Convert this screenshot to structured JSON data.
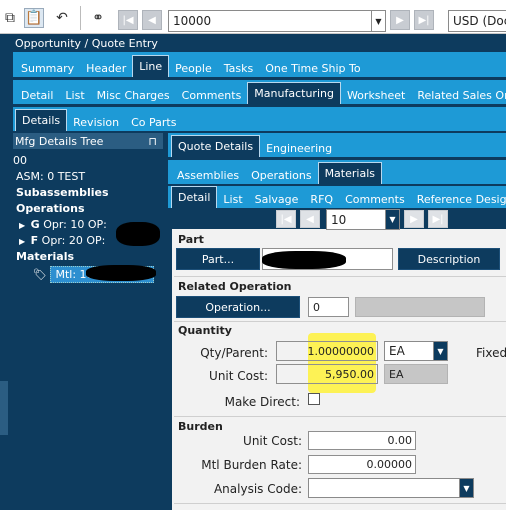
{
  "toolbar": {
    "icons": [
      "copy-icon",
      "clipboard-icon",
      "undo-icon",
      "binoculars-icon"
    ],
    "record_value": "10000",
    "currency_value": "USD (Doc"
  },
  "window_title": "Opportunity / Quote Entry",
  "main_tabs": [
    "Summary",
    "Header",
    "Line",
    "People",
    "Tasks",
    "One Time Ship To"
  ],
  "line_tabs": [
    "Detail",
    "List",
    "Misc Charges",
    "Comments",
    "Manufacturing",
    "Worksheet",
    "Related Sales Order"
  ],
  "mfg_tabs": [
    "Details",
    "Revision",
    "Co Parts"
  ],
  "tree": {
    "header": "Mfg Details Tree",
    "pin": "⊓",
    "line0": "00",
    "asm": "ASM: 0 TEST",
    "subassemblies": "Subassemblies",
    "operations": "Operations",
    "op1": "Opr: 10 OP: ",
    "op2": "Opr: 20 OP: ",
    "materials": "Materials",
    "mtl": "Mtl: 10"
  },
  "detail_tabs": [
    "Quote Details",
    "Engineering"
  ],
  "qd_tabs": [
    "Assemblies",
    "Operations",
    "Materials"
  ],
  "mat_tabs": [
    "Detail",
    "List",
    "Salvage",
    "RFQ",
    "Comments",
    "Reference Design"
  ],
  "seq_value": "10",
  "part": {
    "section": "Part",
    "part_button": "Part...",
    "description_button": "Description"
  },
  "related_operation": {
    "section": "Related Operation",
    "operation_button": "Operation...",
    "operation_value": "0"
  },
  "quantity": {
    "section": "Quantity",
    "qty_parent_label": "Qty/Parent:",
    "qty_parent_value": "1.00000000",
    "qty_uom": "EA",
    "unit_cost_label": "Unit Cost:",
    "unit_cost_value": "5,950.00",
    "unit_cost_uom": "EA",
    "make_direct_label": "Make Direct:",
    "fixed_label": "Fixed"
  },
  "burden": {
    "section": "Burden",
    "unit_cost_label": "Unit Cost:",
    "unit_cost_value": "0.00",
    "rate_label": "Mtl  Burden Rate:",
    "rate_value": "0.00000",
    "analysis_label": "Analysis Code:",
    "analysis_value": ""
  },
  "colors": {
    "navy": "#0d3b5e",
    "tab_blue": "#1e9ad6",
    "highlight": "#fff23a"
  }
}
